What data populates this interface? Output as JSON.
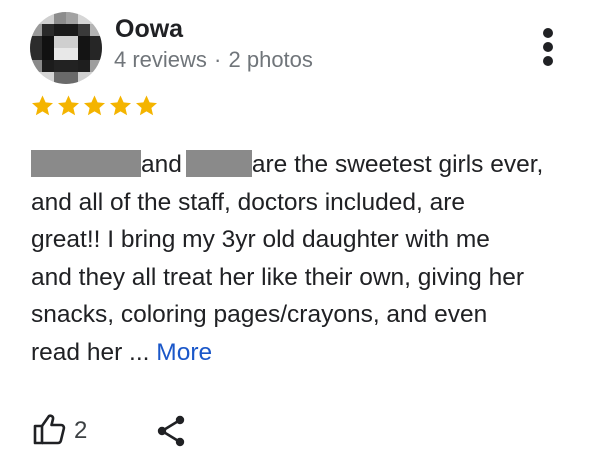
{
  "review": {
    "author": {
      "name": "Oowa",
      "reviews": "4 reviews",
      "separator": "·",
      "photos": "2 photos"
    },
    "rating": 5,
    "star_color": "#f4b400",
    "text": {
      "line1_a": "and",
      "line1_b": "are the sweetest girls ever,",
      "line2": "and all of the staff, doctors included, are",
      "line3": "great!! I bring my 3yr old daughter with me",
      "line4": "and they all treat her like their own, giving her",
      "line5": "snacks, coloring pages/crayons, and even",
      "line6": "read her ... ",
      "more_link": "More"
    },
    "actions": {
      "like_count": "2",
      "like_icon": "thumbs-up-icon",
      "share_icon": "share-icon",
      "menu_icon": "more-vert-icon"
    }
  }
}
